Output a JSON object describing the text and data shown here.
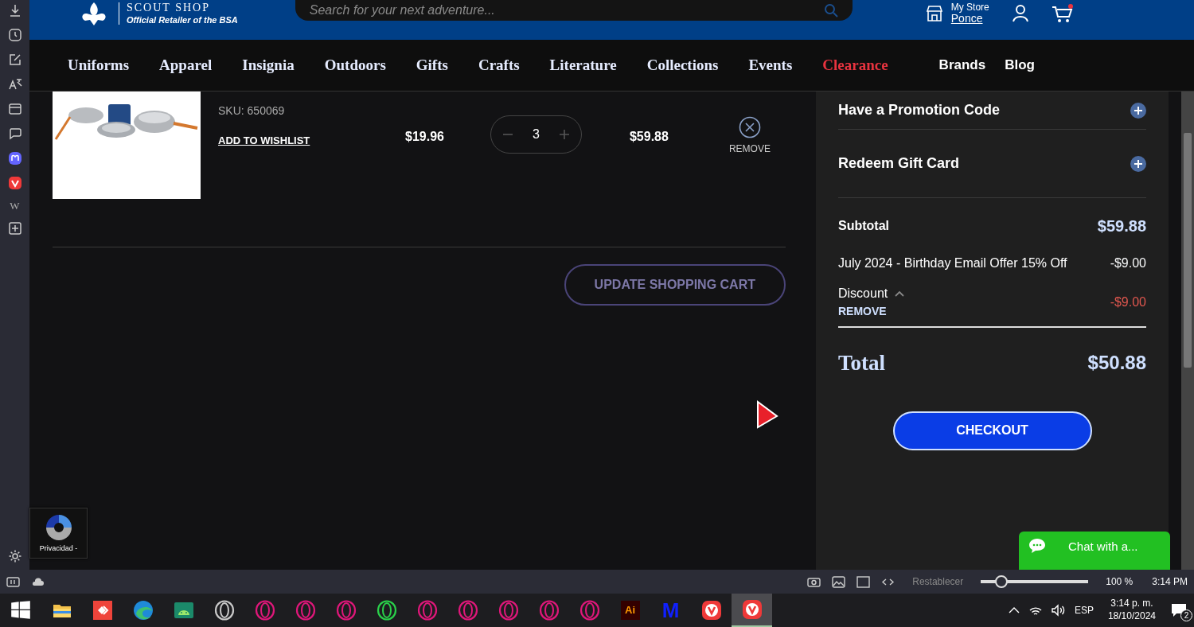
{
  "header": {
    "brand": "SCOUT SHOP",
    "tagline": "Official Retailer of the BSA",
    "search": {
      "placeholder": "Search for your next adventure..."
    },
    "store_label": "My Store",
    "store_name": "Ponce"
  },
  "nav": [
    {
      "label": "Uniforms",
      "kind": "category",
      "highlighted": false
    },
    {
      "label": "Apparel",
      "kind": "category",
      "highlighted": false
    },
    {
      "label": "Insignia",
      "kind": "category",
      "highlighted": false
    },
    {
      "label": "Outdoors",
      "kind": "category",
      "highlighted": false
    },
    {
      "label": "Gifts",
      "kind": "category",
      "highlighted": false
    },
    {
      "label": "Crafts",
      "kind": "category",
      "highlighted": false
    },
    {
      "label": "Literature",
      "kind": "category",
      "highlighted": false
    },
    {
      "label": "Collections",
      "kind": "category",
      "highlighted": false
    },
    {
      "label": "Events",
      "kind": "category",
      "highlighted": false
    },
    {
      "label": "Clearance",
      "kind": "category",
      "highlighted": true
    },
    {
      "label": "Brands",
      "kind": "link",
      "highlighted": false
    },
    {
      "label": "Blog",
      "kind": "link",
      "highlighted": false
    }
  ],
  "cart": {
    "items": [
      {
        "sku": "SKU: 650069",
        "wishlist": "ADD TO WISHLIST",
        "price": "$19.96",
        "quantity": "3",
        "total": "$59.88",
        "remove": "REMOVE"
      }
    ],
    "update_button": "UPDATE SHOPPING CART"
  },
  "summary": {
    "sections": [
      {
        "label": "Have a Promotion Code",
        "expanded": false
      },
      {
        "label": "Redeem Gift Card",
        "expanded": false
      }
    ],
    "subtotal_label": "Subtotal",
    "subtotal": "$59.88",
    "offer_label": "July 2024 - Birthday Email Offer 15% Off",
    "offer_amount": "-$9.00",
    "discount_label": "Discount",
    "discount_expanded": true,
    "discount_remove": "REMOVE",
    "discount_amount": "-$9.00",
    "total_label": "Total",
    "total": "$50.88",
    "checkout": "CHECKOUT"
  },
  "recaptcha": {
    "text": "Privacidad -"
  },
  "chat": {
    "label": "Chat with a..."
  },
  "browser": {
    "sidebar_wiki": "W",
    "reset": "Restablecer",
    "zoom": {
      "level": 0.19
    },
    "zoom_reading": "100 %",
    "clock": "3:14 PM"
  },
  "taskbar": {
    "items": [
      {
        "kind": "windows",
        "selected": false
      },
      {
        "kind": "folder",
        "selected": false
      },
      {
        "kind": "remote",
        "selected": false
      },
      {
        "kind": "edge",
        "selected": false
      },
      {
        "kind": "android",
        "selected": false
      },
      {
        "kind": "ring",
        "color": "#c8c8c8",
        "selected": false
      },
      {
        "kind": "ring",
        "color": "#e0177a",
        "selected": false
      },
      {
        "kind": "ring",
        "color": "#e0177a",
        "selected": false
      },
      {
        "kind": "ring",
        "color": "#e0177a",
        "selected": false
      },
      {
        "kind": "ring",
        "color": "#2ad04a",
        "selected": false
      },
      {
        "kind": "ring",
        "color": "#e0177a",
        "selected": false
      },
      {
        "kind": "ring",
        "color": "#e0177a",
        "selected": false
      },
      {
        "kind": "ring",
        "color": "#e0177a",
        "selected": false
      },
      {
        "kind": "ring",
        "color": "#e0177a",
        "selected": false
      },
      {
        "kind": "ring",
        "color": "#e0177a",
        "selected": false
      },
      {
        "kind": "letters",
        "label": "Ai",
        "selected": false
      },
      {
        "kind": "mono",
        "label": "M",
        "selected": false
      },
      {
        "kind": "vivaldi",
        "selected": false
      },
      {
        "kind": "vivaldi",
        "selected": true
      }
    ],
    "language": "ESP",
    "time": "3:14 p. m.",
    "date": "18/10/2024",
    "notifications": "2"
  }
}
